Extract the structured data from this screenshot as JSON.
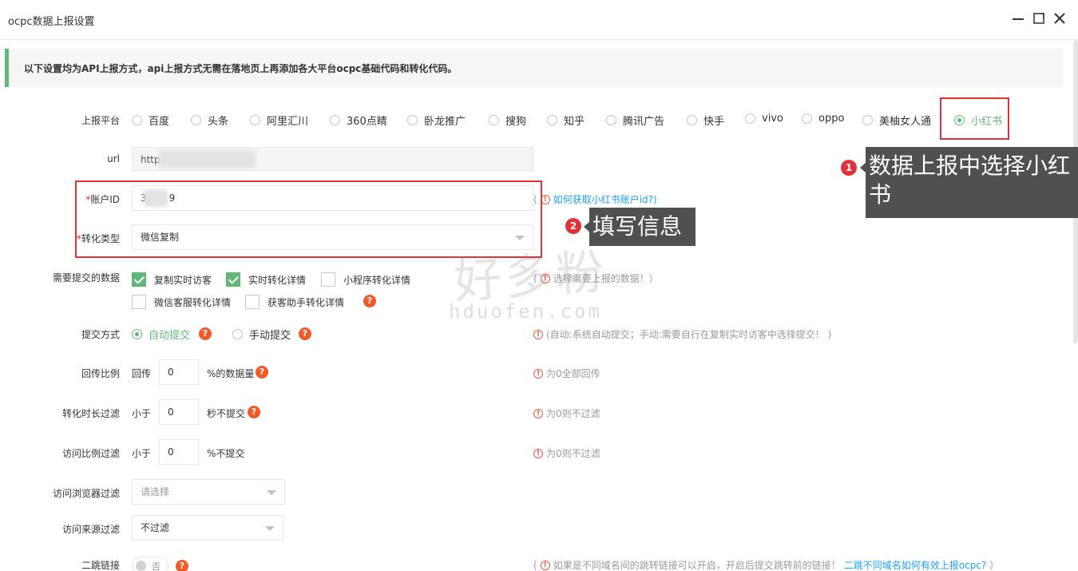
{
  "window": {
    "title": "ocpc数据上报设置"
  },
  "notice": "以下设置均为API上报方式，api上报方式无需在落地页上再添加各大平台ocpc基础代码和转化代码。",
  "platform": {
    "label": "上报平台",
    "options": [
      "百度",
      "头条",
      "阿里汇川",
      "360点睛",
      "卧龙推广",
      "搜狗",
      "知乎",
      "腾讯广告",
      "快手",
      "vivo",
      "oppo",
      "美柚女人通",
      "小红书"
    ],
    "selected": "小红书"
  },
  "url": {
    "label": "url",
    "value": "http"
  },
  "account": {
    "label": "账户ID",
    "required_mark": "*",
    "value_prefix": "3",
    "value_suffix": "9",
    "help_open": "(",
    "help_link": "如何获取小红书账户id?)"
  },
  "conversion_type": {
    "label": "转化类型",
    "required_mark": "*",
    "value": "微信复制"
  },
  "submit_data": {
    "label": "需要提交的数据",
    "options": [
      {
        "label": "复制实时访客",
        "checked": true
      },
      {
        "label": "实时转化详情",
        "checked": true
      },
      {
        "label": "小程序转化详情",
        "checked": false
      },
      {
        "label": "微信客服转化详情",
        "checked": false
      },
      {
        "label": "获客助手转化详情",
        "checked": false
      }
    ],
    "hint": "选择需要上报的数据！）"
  },
  "submit_mode": {
    "label": "提交方式",
    "options": [
      "自动提交",
      "手动提交"
    ],
    "selected": "自动提交",
    "hint": "(自动:系统自动提交；手动:需要自行在复制实时访客中选择提交！ )"
  },
  "ratio": {
    "label": "回传比例",
    "prefix": "回传",
    "value": "0",
    "suffix": "%的数据量",
    "hint": "为0全部回传"
  },
  "duration_filter": {
    "label": "转化时长过滤",
    "prefix": "小于",
    "value": "0",
    "suffix": "秒不提交",
    "hint": "为0则不过滤"
  },
  "visit_ratio_filter": {
    "label": "访问比例过滤",
    "prefix": "小于",
    "value": "0",
    "suffix": "%不提交",
    "hint": "为0则不过滤"
  },
  "browser_filter": {
    "label": "访问浏览器过滤",
    "placeholder": "请选择"
  },
  "source_filter": {
    "label": "访问来源过滤",
    "value": "不过滤"
  },
  "redirect": {
    "label": "二跳链接",
    "toggle_text": "否",
    "hint": "如果是不同域名间的跳转链接可以开启，开启后提交跳转前的链接！",
    "link": "二跳不同域名如何有效上报ocpc?",
    "hint_close": "）"
  },
  "annotations": {
    "step1_badge": "1",
    "step1_text": "数据上报中选择小红书",
    "step2_badge": "2",
    "step2_text": "填写信息"
  },
  "watermark": {
    "cn": "好多粉",
    "en": "hduofen.com"
  },
  "colors": {
    "accent": "#5fb878",
    "annotation_red": "#e0323a",
    "help_orange": "#f05a28",
    "link": "#1e9fff"
  }
}
